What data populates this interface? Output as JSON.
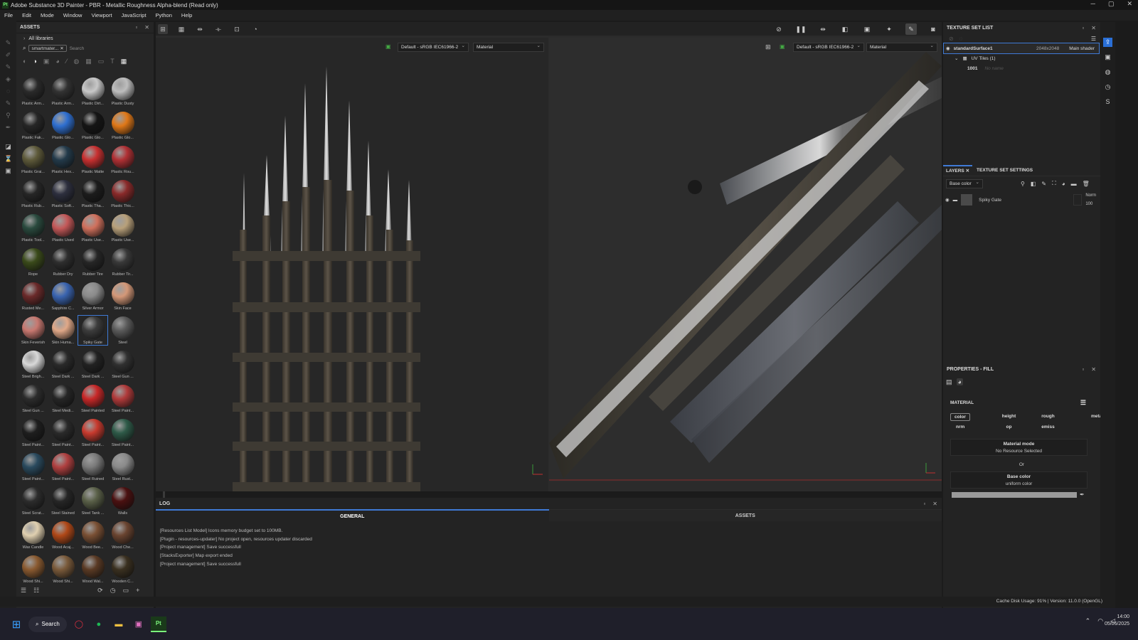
{
  "window": {
    "title": "Adobe Substance 3D Painter - PBR - Metallic Roughness Alpha-blend (Read only)",
    "app_badge": "Pt",
    "min": "─",
    "max": "▢",
    "close": "✕"
  },
  "menu": [
    "File",
    "Edit",
    "Mode",
    "Window",
    "Viewport",
    "JavaScript",
    "Python",
    "Help"
  ],
  "assets": {
    "title": "ASSETS",
    "all_libraries": "All libraries",
    "search_tag": "smartmater...",
    "search_placeholder": "Search",
    "items": [
      {
        "label": "Plastic Arm...",
        "color": "#2a2a2a"
      },
      {
        "label": "Plastic Arm...",
        "color": "#323232"
      },
      {
        "label": "Plastic Dirt...",
        "color": "#c8c8c8"
      },
      {
        "label": "Plastic Dusty",
        "color": "#bdbdbd"
      },
      {
        "label": "Plastic Fak...",
        "color": "#262626"
      },
      {
        "label": "Plastic Glo...",
        "color": "#2f6fd0"
      },
      {
        "label": "Plastic Glo...",
        "color": "#151515"
      },
      {
        "label": "Plastic Glo...",
        "color": "#e07818"
      },
      {
        "label": "Plastic Grai...",
        "color": "#5e5a3a"
      },
      {
        "label": "Plastic Hex...",
        "color": "#233a4a"
      },
      {
        "label": "Plastic Matte",
        "color": "#c83030"
      },
      {
        "label": "Plastic Rou...",
        "color": "#b03034"
      },
      {
        "label": "Plastic Rub...",
        "color": "#262626"
      },
      {
        "label": "Plastic Soft...",
        "color": "#2d2f3e"
      },
      {
        "label": "Plastic Tha...",
        "color": "#1c1c1c"
      },
      {
        "label": "Plastic Thic...",
        "color": "#8a2a2a"
      },
      {
        "label": "Plastic Tool...",
        "color": "#2a4a3e"
      },
      {
        "label": "Plastic Used",
        "color": "#c45858"
      },
      {
        "label": "Plastic Use...",
        "color": "#d0705c"
      },
      {
        "label": "Plastic Use...",
        "color": "#b8a07a"
      },
      {
        "label": "Rope",
        "color": "#3a4a1a"
      },
      {
        "label": "Rubber Dry",
        "color": "#2e2e2e"
      },
      {
        "label": "Rubber Tire",
        "color": "#262626"
      },
      {
        "label": "Rubber Tir...",
        "color": "#383838"
      },
      {
        "label": "Rusted Me...",
        "color": "#6a2a2a"
      },
      {
        "label": "Sapphire C...",
        "color": "#3a64b0"
      },
      {
        "label": "Silver Armor",
        "color": "#8a8a8a"
      },
      {
        "label": "Skin Face",
        "color": "#d49878"
      },
      {
        "label": "Skin Feverish",
        "color": "#c87870"
      },
      {
        "label": "Skin Huma...",
        "color": "#e0a888"
      },
      {
        "label": "Spiky Gate",
        "color": "#3c3c3c",
        "selected": true
      },
      {
        "label": "Steel",
        "color": "#5a5a5a"
      },
      {
        "label": "Steel Brigh...",
        "color": "#d8d8d8"
      },
      {
        "label": "Steel Dark ...",
        "color": "#2a2a2a"
      },
      {
        "label": "Steel Dark ...",
        "color": "#222"
      },
      {
        "label": "Steel Gun ...",
        "color": "#303030"
      },
      {
        "label": "Steel Gun ...",
        "color": "#2c2c2c"
      },
      {
        "label": "Steel Medi...",
        "color": "#262626"
      },
      {
        "label": "Steel Painted",
        "color": "#c82828"
      },
      {
        "label": "Steel Paint...",
        "color": "#b03a3a"
      },
      {
        "label": "Steel Paint...",
        "color": "#1e1e1e"
      },
      {
        "label": "Steel Paint...",
        "color": "#2a2a2a"
      },
      {
        "label": "Steel Paint...",
        "color": "#c83a2e"
      },
      {
        "label": "Steel Paint...",
        "color": "#2e5a48"
      },
      {
        "label": "Steel Paint...",
        "color": "#2a4a5e"
      },
      {
        "label": "Steel Paint...",
        "color": "#b04040"
      },
      {
        "label": "Steel Ruined",
        "color": "#7a7a7a"
      },
      {
        "label": "Steel Rust...",
        "color": "#8a8a8a"
      },
      {
        "label": "Steel Scrat...",
        "color": "#2c2c2c"
      },
      {
        "label": "Steel Stained",
        "color": "#262626"
      },
      {
        "label": "Steel Tank ...",
        "color": "#5a6048"
      },
      {
        "label": "Walls",
        "color": "#4a1010"
      },
      {
        "label": "Wax Candle",
        "color": "#e0d0b0"
      },
      {
        "label": "Wood Acaj...",
        "color": "#b04818"
      },
      {
        "label": "Wood Bee...",
        "color": "#7a5034"
      },
      {
        "label": "Wood Che...",
        "color": "#6a4430"
      },
      {
        "label": "Wood Shi...",
        "color": "#8a5a30"
      },
      {
        "label": "Wood Shi...",
        "color": "#7a5a3a"
      },
      {
        "label": "Wood Wal...",
        "color": "#5a3a24"
      },
      {
        "label": "Wooden C...",
        "color": "#3a3020"
      }
    ]
  },
  "viewport": {
    "left_colorspace": "Default - sRGB IEC61966-2",
    "left_channel": "Material",
    "right_colorspace": "Default - sRGB IEC61966-2",
    "right_channel": "Material"
  },
  "log": {
    "title": "LOG",
    "tab_general": "GENERAL",
    "tab_assets": "ASSETS",
    "lines": [
      "[Resources List Model] Icons memory budget set to 100MB.",
      "[Plugin - resources-updater] No project open, resources updater discarded",
      "[Project management] Save successfull",
      "[StacksExporter] Map export ended",
      "[Project management] Save successfull"
    ]
  },
  "texture_set": {
    "title": "TEXTURE SET LIST",
    "name": "standardSurface1",
    "resolution": "2048x2048",
    "shader": "Main shader",
    "uv_tiles": "UV Tiles (1)",
    "tile_id": "1001",
    "tile_name": "No name"
  },
  "layers": {
    "tab_layers": "LAYERS",
    "tab_settings": "TEXTURE SET SETTINGS",
    "channel": "Base color",
    "layer_name": "Spiky Gate",
    "blend": "Norm",
    "opacity": "100"
  },
  "properties": {
    "title": "PROPERTIES - FILL",
    "material_header": "MATERIAL",
    "channels": [
      "color",
      "height",
      "rough",
      "metal",
      "nrm",
      "op",
      "emiss"
    ],
    "material_mode": "Material mode",
    "no_resource": "No Resource Selected",
    "or": "Or",
    "base_color": "Base color",
    "uniform": "uniform color"
  },
  "status": {
    "text": "Cache Disk Usage:   91% | Version: 11.0.0 (OpenGL)"
  },
  "taskbar": {
    "search": "Search",
    "time": "14:00",
    "date": "05/05/2025"
  },
  "colors": {
    "accent": "#3f7ad6",
    "app_bg": "#1b1b1b",
    "panel": "#262626"
  }
}
